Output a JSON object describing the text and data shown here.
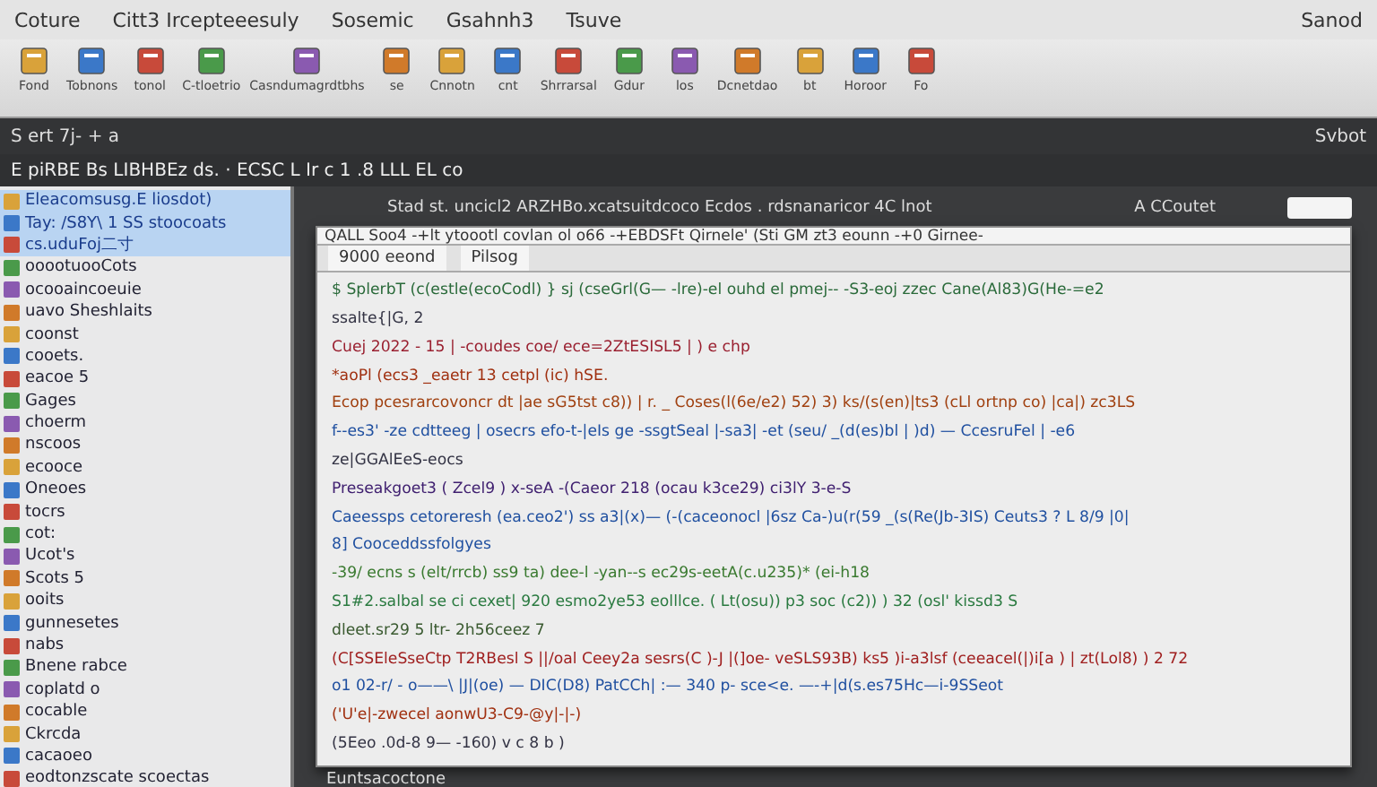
{
  "menu_bar": {
    "items": [
      "Coture",
      "Citt3 Ircepteeesuly",
      "Sosemic",
      "Gsahnh3",
      "Tsuve"
    ],
    "right": "Sanod"
  },
  "toolbar": {
    "items": [
      "Fond",
      "Tobnons",
      "tonol",
      "C-tloetrio",
      "Casndumagrdtbhs",
      "se",
      "Cnnotn",
      "cnt",
      "Shrrarsal",
      "Gdur",
      "los",
      "Dcnetdao",
      "bt",
      "Horoor",
      "Fo"
    ]
  },
  "status_row": {
    "left": "S   ert 7j- + a",
    "right": "Svbot"
  },
  "path_row": {
    "text": "E piRBE Bs  LIBHBEz  ds.  · ECSC  L  Ir  c 1 .8  LLL    EL  co"
  },
  "sidebar": {
    "items": [
      {
        "label": "Eleacomsusg.E liosdot)",
        "selected": true
      },
      {
        "label": "Tay: /S8Y\\ 1 SS stoocoats",
        "selected": true
      },
      {
        "label": "cs.uduFoj二寸",
        "selected": true
      },
      {
        "label": "ooootuooCots",
        "selected": false
      },
      {
        "label": "ocooaincoeuie",
        "selected": false
      },
      {
        "label": "uavo Sheshlaits",
        "selected": false
      },
      {
        "label": "coonst",
        "selected": false
      },
      {
        "label": "cooets.",
        "selected": false
      },
      {
        "label": "eacoe 5",
        "selected": false
      },
      {
        "label": "Gages",
        "selected": false
      },
      {
        "label": "choerm",
        "selected": false
      },
      {
        "label": "nscoos",
        "selected": false
      },
      {
        "label": "ecooce",
        "selected": false
      },
      {
        "label": "Oneoes",
        "selected": false
      },
      {
        "label": "tocrs",
        "selected": false
      },
      {
        "label": "cot:",
        "selected": false
      },
      {
        "label": "Ucot's",
        "selected": false
      },
      {
        "label": "Scots 5",
        "selected": false
      },
      {
        "label": "ooits",
        "selected": false
      },
      {
        "label": "gunnesetes",
        "selected": false
      },
      {
        "label": "nabs",
        "selected": false
      },
      {
        "label": "Bnene rabce",
        "selected": false
      },
      {
        "label": "coplatd o",
        "selected": false
      },
      {
        "label": "cocable",
        "selected": false
      },
      {
        "label": "Ckrcda",
        "selected": false
      },
      {
        "label": "cacaoeo",
        "selected": false
      },
      {
        "label": "eodtonzscate scoectas",
        "selected": false
      }
    ]
  },
  "main_header": {
    "text": "Stad st.  uncicl2 ARZHBo.xcatsuitdcoco Ecdos . rdsnanaricor 4C lnot",
    "right": "A CCoutet"
  },
  "editor": {
    "title": "QALL  Soo4 -+lt ytoootl covlan ol o66 -+EBDSFt  Qirnele'  (Sti   GM  zt3   eounn -+0 Girnee-",
    "tab": "9000 eeond",
    "tab2": "Pilsog",
    "lines": [
      {
        "text": "$ SplerbT (c(estle(ecoCodl) } sj  (cseGrl(G— -lre)-el ouhd  el pmej-- -S3-eoj zzec Cane(Al83)G(He-=e2",
        "color": "#2a6a3a"
      },
      {
        "text": "ssalte{|G, 2",
        "color": "#333344"
      },
      {
        "text": "Cuej 2022 - 15 | -coudes coe/ ece=2ZtESISL5 | ) e chp",
        "color": "#9a2030"
      },
      {
        "text": "*aoPl (ecs3 _eaetr 13  cetpl (ic) hSE.",
        "color": "#a03010"
      },
      {
        "text": "Ecop pcesrarcovoncr  dt  |ae  sG5tst  c8)) | r.  _ Coses(l(6e/e2) 52)  3)  ks/(s(en)|ts3 (cLl ortnp co) |ca|) zc3LS",
        "color": "#a04010"
      },
      {
        "text": "f--es3' -ze  cdtteeg | osecrs  efo-t-|eIs ge -ssgtSeal |-sa3| -et  (seu/ _(d(es)bl | )d) — CcesruFel  | -e6",
        "color": "#2050a0"
      },
      {
        "text": "ze|GGAlEeS-eocs",
        "color": "#333344"
      },
      {
        "text": "Preseakgoet3 ( Zcel9 ) x-seA  -(Caeor 218 (ocau k3ce29) ci3lY 3-e-S",
        "color": "#402070"
      },
      {
        "text": "Caeessps cetoreresh (ea.ceo2') ss a3|(x)— (-(caceonocl  |6sz Ca-)u(r(59 _(s(Re(Jb-3IS) Ceuts3 ? L 8/9 |0|",
        "color": "#2050a0"
      },
      {
        "text": "8] Cooceddssfolgyes",
        "color": "#2050a0"
      },
      {
        "text": "-39/ ecns s (elt/rrcb) ss9 ta) dee-l -yan--s ec29s-eetA(c.u235)* (ei-h18",
        "color": "#3a7a30"
      },
      {
        "text": "S1#2.salbal se ci cexet| 920 esmo2ye53 eolllce. ( Lt(osu)) p3 soc (c2)) ) 32 (osl' kissd3 S",
        "color": "#2a7a40"
      },
      {
        "text": "dleet.sr29 5 ltr- 2h56ceez 7",
        "color": "#3a5a30"
      },
      {
        "text": "(C[SSEleSseCtp   T2RBesl S  ||/oal  Ceey2a sesrs(C )-J |(]oe- veSLS93B)  ks5 )i-a3lsf (ceeacel(|)i[a ) | zt(Lol8) ) 2 72",
        "color": "#a02020"
      },
      {
        "text": "o1 02-r/ - o——\\ |J|(oe) — DIC(D8) PatCCh| :— 340 p- sce<e.  —-+|d(s.es75Hc—i-9SSeot",
        "color": "#2050a0"
      },
      {
        "text": "('U'e|-zwecel aonwU3-C9-@y|-|-)",
        "color": "#a03010"
      },
      {
        "text": "(5Eeo  .0d-8 9— -160) v c 8 b )",
        "color": "#333344"
      }
    ]
  },
  "status_bar": {
    "text": "Euntsacoctone"
  }
}
